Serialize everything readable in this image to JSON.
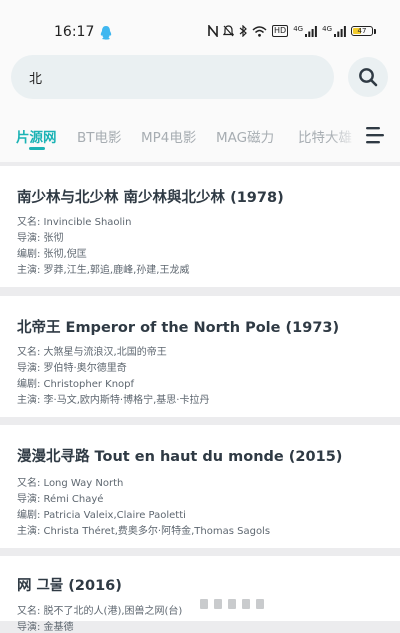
{
  "status_bar": {
    "time": "16:17",
    "hd": "HD",
    "net1": "4G",
    "net2": "4G",
    "battery": "47"
  },
  "search": {
    "value": "北"
  },
  "tabs": [
    {
      "label": "片源网",
      "active": true
    },
    {
      "label": "BT电影",
      "active": false
    },
    {
      "label": "MP4电影",
      "active": false
    },
    {
      "label": "MAG磁力",
      "active": false
    },
    {
      "label": "比特大雄",
      "active": false
    }
  ],
  "movies": [
    {
      "title": "南少林与北少林 南少林與北少林 (1978)",
      "aka": "又名: Invincible Shaolin",
      "director": "导演: 张彻",
      "writer": "编剧: 张彻,倪匡",
      "cast": "主演: 罗莽,江生,郭追,鹿峰,孙建,王龙威"
    },
    {
      "title": "北帝王 Emperor of the North Pole (1973)",
      "aka": "又名: 大煞星与流浪汉,北国的帝王",
      "director": "导演: 罗伯特·奥尔德里奇",
      "writer": "编剧: Christopher Knopf",
      "cast": "主演: 李·马文,欧内斯特·博格宁,基思·卡拉丹"
    },
    {
      "title": "漫漫北寻路 Tout en haut du monde (2015)",
      "aka": "又名: Long Way North",
      "director": "导演: Rémi Chayé",
      "writer": "编剧: Patricia Valeix,Claire Paoletti",
      "cast": "主演: Christa Théret,费奥多尔·阿特金,Thomas Sagols"
    },
    {
      "title": "网 그물 (2016)",
      "aka": "又名: 脱不了北的人(港),困兽之网(台)",
      "director": "导演: 金基德"
    }
  ],
  "colors": {
    "accent": "#1cb3b5",
    "tab_inactive": "#a7adb2",
    "background": "#ececee",
    "search_bg": "#eaf0f2"
  }
}
